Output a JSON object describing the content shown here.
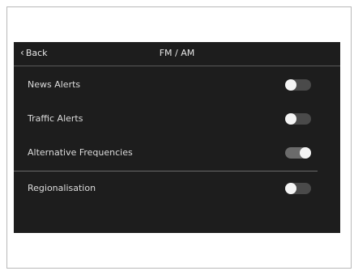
{
  "header": {
    "back_label": "Back",
    "back_icon": "chevron-left-icon",
    "title": "FM / AM"
  },
  "settings": [
    {
      "label": "News Alerts",
      "on": false
    },
    {
      "label": "Traffic Alerts",
      "on": false
    },
    {
      "label": "Alternative Frequencies",
      "on": true
    },
    {
      "label": "Regionalisation",
      "on": false
    }
  ],
  "colors": {
    "background": "#1d1d1d",
    "text": "#e6e6e6",
    "toggle_off": "#4a4a4a",
    "toggle_on": "#6b6b6b",
    "knob": "#f4f4f4"
  }
}
